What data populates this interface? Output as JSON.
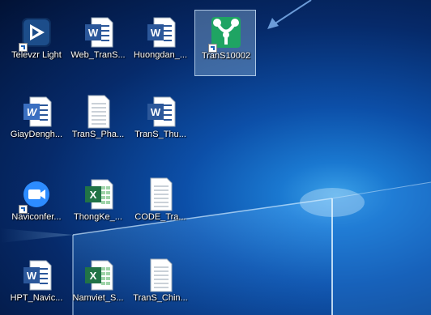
{
  "desktop": {
    "icons": [
      {
        "label": "Televzr Light",
        "icon": "televzr-app-icon"
      },
      {
        "label": "Web_TranS...",
        "icon": "word-document-icon"
      },
      {
        "label": "Huongdan_...",
        "icon": "word-document-icon"
      },
      {
        "label": "TranS10002",
        "icon": "trans-app-icon"
      },
      {
        "label": "GiayDengh...",
        "icon": "word-document-icon"
      },
      {
        "label": "TranS_Pha...",
        "icon": "text-document-icon"
      },
      {
        "label": "TranS_Thu...",
        "icon": "word-document-icon"
      },
      {
        "label": "Naviconfer...",
        "icon": "video-conference-app-icon"
      },
      {
        "label": "ThongKe_...",
        "icon": "excel-spreadsheet-icon"
      },
      {
        "label": "CODE_Tra...",
        "icon": "text-document-icon"
      },
      {
        "label": "HPT_Navic...",
        "icon": "word-document-icon"
      },
      {
        "label": "Namviet_S...",
        "icon": "excel-spreadsheet-icon"
      },
      {
        "label": "TranS_Chin...",
        "icon": "text-document-icon"
      }
    ]
  },
  "colors": {
    "word_blue": "#2b579a",
    "excel_green": "#217346",
    "trans_green": "#1fa463",
    "arrow_blue": "#6b9bd8"
  }
}
